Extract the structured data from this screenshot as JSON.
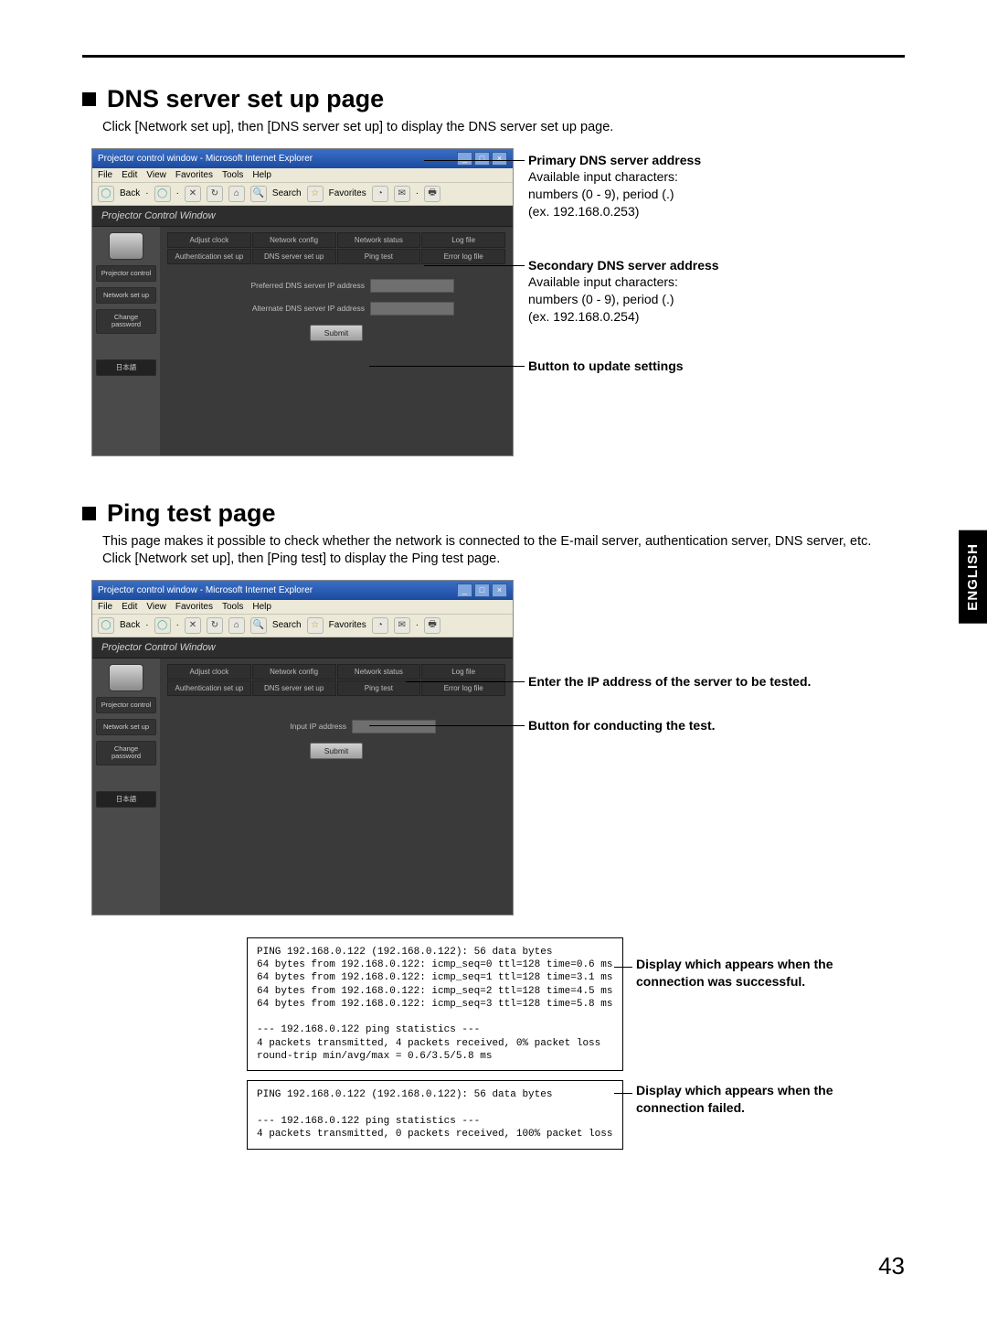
{
  "side_tab": "ENGLISH",
  "page_number": "43",
  "section1": {
    "title": "DNS server set up page",
    "caption": "Click [Network set up], then [DNS server set up] to display the DNS server set up page."
  },
  "section2": {
    "title": "Ping test page",
    "caption1": "This page makes it possible to check whether the network is connected to the E-mail server, authentication server, DNS server, etc.",
    "caption2": "Click [Network set up], then [Ping test] to display the Ping test page."
  },
  "browser": {
    "title": "Projector control window - Microsoft Internet Explorer",
    "menu": [
      "File",
      "Edit",
      "View",
      "Favorites",
      "Tools",
      "Help"
    ],
    "toolbar": {
      "back": "Back",
      "search": "Search",
      "favorites": "Favorites"
    },
    "header": "Projector Control Window",
    "nav": {
      "projector_control": "Projector\ncontrol",
      "network_setup": "Network\nset up",
      "change_password": "Change\npassword",
      "japanese": "日本語"
    },
    "tabs_row1": [
      "Adjust clock",
      "Network config",
      "Network status",
      "Log file"
    ],
    "tabs_row2": [
      "Authentication set up",
      "DNS server set up",
      "Ping test",
      "Error log file"
    ]
  },
  "dns_form": {
    "field1_label": "Preferred DNS server IP address",
    "field2_label": "Alternate DNS server IP address",
    "submit": "Submit"
  },
  "ping_form": {
    "field1_label": "Input IP address",
    "submit": "Submit"
  },
  "callouts_dns": {
    "primary_head": "Primary DNS server address",
    "primary_l1": "Available input characters:",
    "primary_l2": "numbers (0 - 9), period (.)",
    "primary_l3": "(ex. 192.168.0.253)",
    "secondary_head": "Secondary DNS server address",
    "secondary_l1": "Available input characters:",
    "secondary_l2": "numbers (0 - 9), period (.)",
    "secondary_l3": "(ex. 192.168.0.254)",
    "button_head": "Button to update settings"
  },
  "callouts_ping": {
    "ip_head": "Enter the IP address of the server to be tested.",
    "btn_head": "Button for conducting the test.",
    "success_head": "Display which appears when the connection was successful.",
    "fail_head": "Display which appears when the connection failed."
  },
  "ping_success": "PING 192.168.0.122 (192.168.0.122): 56 data bytes\n64 bytes from 192.168.0.122: icmp_seq=0 ttl=128 time=0.6 ms\n64 bytes from 192.168.0.122: icmp_seq=1 ttl=128 time=3.1 ms\n64 bytes from 192.168.0.122: icmp_seq=2 ttl=128 time=4.5 ms\n64 bytes from 192.168.0.122: icmp_seq=3 ttl=128 time=5.8 ms\n\n--- 192.168.0.122 ping statistics ---\n4 packets transmitted, 4 packets received, 0% packet loss\nround-trip min/avg/max = 0.6/3.5/5.8 ms",
  "ping_fail": "PING 192.168.0.122 (192.168.0.122): 56 data bytes\n\n--- 192.168.0.122 ping statistics ---\n4 packets transmitted, 0 packets received, 100% packet loss"
}
